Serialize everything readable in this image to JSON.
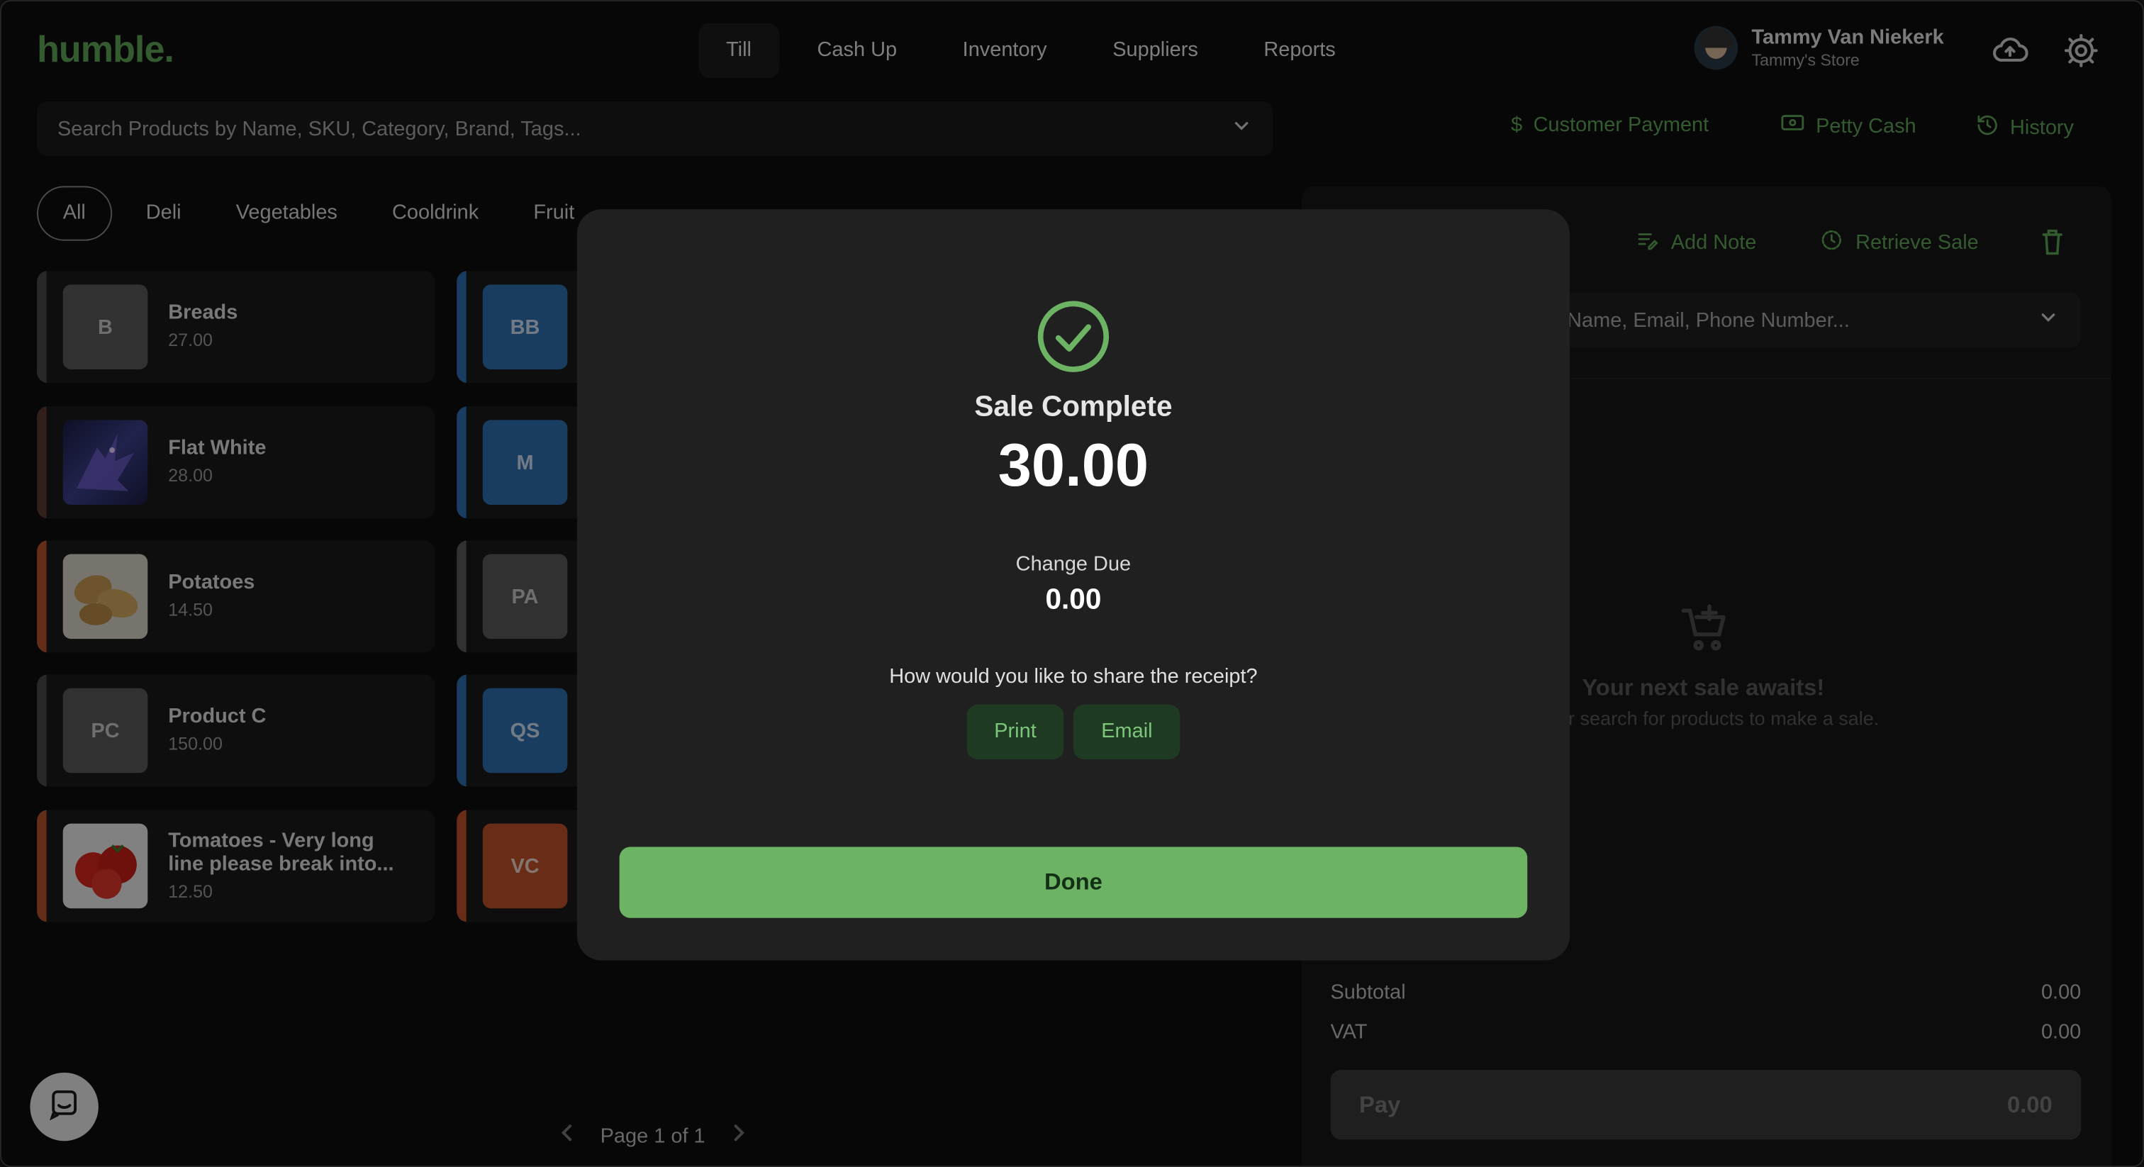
{
  "app": {
    "logo": "humble."
  },
  "nav": {
    "tabs": [
      {
        "label": "Till",
        "active": true
      },
      {
        "label": "Cash Up"
      },
      {
        "label": "Inventory"
      },
      {
        "label": "Suppliers"
      },
      {
        "label": "Reports"
      }
    ]
  },
  "user": {
    "name": "Tammy Van Niekerk",
    "store": "Tammy's Store"
  },
  "icons": {
    "cloud": "cloud-upload-icon",
    "settings": "gear-icon"
  },
  "search": {
    "placeholder": "Search Products by Name, SKU, Category, Brand, Tags..."
  },
  "quick_actions": {
    "customer_payment": "Customer Payment",
    "petty_cash": "Petty Cash",
    "history": "History"
  },
  "categories": [
    "All",
    "Deli",
    "Vegetables",
    "Cooldrink",
    "Fruit"
  ],
  "products_left": [
    {
      "initials": "B",
      "name": "Breads",
      "price": "27.00",
      "strip": "#4a4a4a",
      "thumb_bg": "#5a5a5a"
    },
    {
      "initials": "",
      "name": "Flat White",
      "price": "28.00",
      "strip": "#5a3a30",
      "thumb_bg": "#2a2c5a",
      "image": "dragon"
    },
    {
      "initials": "",
      "name": "Potatoes",
      "price": "14.50",
      "strip": "#b4532c",
      "thumb_bg": "#cfc9b8",
      "image": "potatoes"
    },
    {
      "initials": "PC",
      "name": "Product C",
      "price": "150.00",
      "strip": "#4a4a4a",
      "thumb_bg": "#5a5a5a"
    },
    {
      "initials": "",
      "name": "Tomatoes - Very long line please break into...",
      "price": "12.50",
      "strip": "#b4532c",
      "thumb_bg": "#e8e8e8",
      "image": "tomatoes"
    }
  ],
  "products_right": [
    {
      "initials": "BB",
      "strip": "#2f6fb0",
      "thumb_bg": "#2f6fb0"
    },
    {
      "initials": "M",
      "strip": "#2f6fb0",
      "thumb_bg": "#2f6fb0"
    },
    {
      "initials": "PA",
      "strip": "#5a5a5a",
      "thumb_bg": "#5a5a5a"
    },
    {
      "initials": "QS",
      "strip": "#2f6fb0",
      "thumb_bg": "#2f6fb0"
    },
    {
      "initials": "VC",
      "strip": "#c0502a",
      "thumb_bg": "#c0502a"
    }
  ],
  "sale_panel": {
    "add_note": "Add Note",
    "retrieve_sale": "Retrieve Sale",
    "customer_search_placeholder": "Name, Email, Phone Number...",
    "empty_title": "Your next sale awaits!",
    "empty_sub": "r search for products to make a sale.",
    "subtotal_label": "Subtotal",
    "subtotal": "0.00",
    "vat_label": "VAT",
    "vat": "0.00",
    "pay_label": "Pay",
    "pay_amount": "0.00"
  },
  "pager": {
    "text": "Page 1 of 1"
  },
  "modal": {
    "title": "Sale Complete",
    "amount": "30.00",
    "change_label": "Change Due",
    "change_amount": "0.00",
    "share_prompt": "How would you like to share the receipt?",
    "print": "Print",
    "email": "Email",
    "done": "Done"
  },
  "colors": {
    "accent": "#5fa456",
    "done_button": "#6db364",
    "background": "#0d0d0d"
  }
}
